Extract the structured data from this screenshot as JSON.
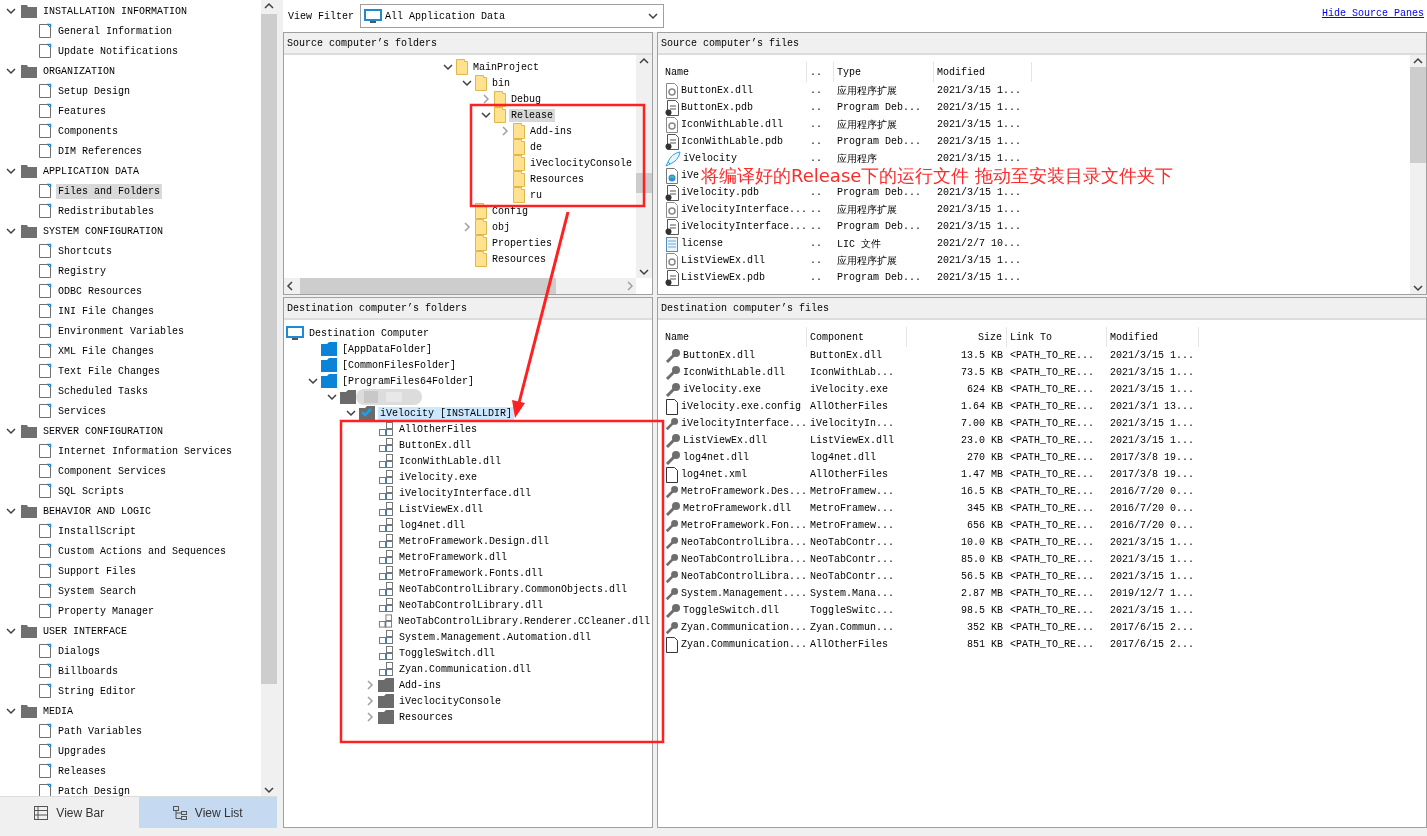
{
  "sidebar": {
    "groups": [
      {
        "label": "INSTALLATION INFORMATION",
        "expanded": true,
        "items": [
          {
            "label": "General Information",
            "selected": false
          },
          {
            "label": "Update Notifications",
            "selected": false
          }
        ]
      },
      {
        "label": "ORGANIZATION",
        "expanded": true,
        "items": [
          {
            "label": "Setup Design",
            "selected": false
          },
          {
            "label": "Features",
            "selected": false
          },
          {
            "label": "Components",
            "selected": false
          },
          {
            "label": "DIM References",
            "selected": false
          }
        ]
      },
      {
        "label": "APPLICATION DATA",
        "expanded": true,
        "items": [
          {
            "label": "Files and Folders",
            "selected": true
          },
          {
            "label": "Redistributables",
            "selected": false
          }
        ]
      },
      {
        "label": "SYSTEM CONFIGURATION",
        "expanded": true,
        "items": [
          {
            "label": "Shortcuts",
            "selected": false
          },
          {
            "label": "Registry",
            "selected": false
          },
          {
            "label": "ODBC Resources",
            "selected": false
          },
          {
            "label": "INI File Changes",
            "selected": false
          },
          {
            "label": "Environment Variables",
            "selected": false
          },
          {
            "label": "XML File Changes",
            "selected": false
          },
          {
            "label": "Text File Changes",
            "selected": false
          },
          {
            "label": "Scheduled Tasks",
            "selected": false
          },
          {
            "label": "Services",
            "selected": false
          }
        ]
      },
      {
        "label": "SERVER CONFIGURATION",
        "expanded": true,
        "items": [
          {
            "label": "Internet Information Services",
            "selected": false
          },
          {
            "label": "Component Services",
            "selected": false
          },
          {
            "label": "SQL Scripts",
            "selected": false
          }
        ]
      },
      {
        "label": "BEHAVIOR AND LOGIC",
        "expanded": true,
        "items": [
          {
            "label": "InstallScript",
            "selected": false
          },
          {
            "label": "Custom Actions and Sequences",
            "selected": false
          },
          {
            "label": "Support Files",
            "selected": false
          },
          {
            "label": "System Search",
            "selected": false
          },
          {
            "label": "Property Manager",
            "selected": false
          }
        ]
      },
      {
        "label": "USER INTERFACE",
        "expanded": true,
        "items": [
          {
            "label": "Dialogs",
            "selected": false
          },
          {
            "label": "Billboards",
            "selected": false
          },
          {
            "label": "String Editor",
            "selected": false
          }
        ]
      },
      {
        "label": "MEDIA",
        "expanded": true,
        "items": [
          {
            "label": "Path Variables",
            "selected": false
          },
          {
            "label": "Upgrades",
            "selected": false
          },
          {
            "label": "Releases",
            "selected": false
          },
          {
            "label": "Patch Design",
            "selected": false
          }
        ]
      }
    ],
    "tabs": [
      {
        "label": "View Bar",
        "selected": false
      },
      {
        "label": "View List",
        "selected": true
      }
    ]
  },
  "toolbar": {
    "filter_label": "View Filter",
    "filter_value": "All Application Data",
    "link": "Hide Source Panes"
  },
  "source_folders": {
    "title": "Source computer’s folders",
    "tree": [
      {
        "label": "MainProject",
        "expanded": true,
        "selected": false,
        "children": [
          {
            "label": "bin",
            "expanded": true,
            "selected": false,
            "children": [
              {
                "label": "Debug",
                "expanded": false,
                "selected": false
              },
              {
                "label": "Release",
                "expanded": true,
                "selected": true,
                "children": [
                  {
                    "label": "Add-ins",
                    "expanded": false,
                    "selected": false
                  },
                  {
                    "label": "de",
                    "selected": false
                  },
                  {
                    "label": "iVeclocityConsole",
                    "selected": false
                  },
                  {
                    "label": "Resources",
                    "selected": false
                  },
                  {
                    "label": "ru",
                    "selected": false
                  }
                ]
              }
            ]
          },
          {
            "label": "Config",
            "selected": false
          },
          {
            "label": "obj",
            "expanded": false,
            "selected": false
          },
          {
            "label": "Properties",
            "selected": false
          },
          {
            "label": "Resources",
            "selected": false
          }
        ]
      }
    ]
  },
  "source_files": {
    "title": "Source computer’s files",
    "columns": [
      "Name",
      "..",
      "Type",
      "Modified"
    ],
    "rows": [
      {
        "kind": "dll",
        "cells": [
          "ButtonEx.dll",
          "..",
          "应用程序扩展",
          "2021/3/15 1..."
        ]
      },
      {
        "kind": "pdb",
        "cells": [
          "ButtonEx.pdb",
          "..",
          "Program Deb...",
          "2021/3/15 1..."
        ]
      },
      {
        "kind": "dll",
        "cells": [
          "IconWithLable.dll",
          "..",
          "应用程序扩展",
          "2021/3/15 1..."
        ]
      },
      {
        "kind": "pdb",
        "cells": [
          "IconWithLable.pdb",
          "..",
          "Program Deb...",
          "2021/3/15 1..."
        ]
      },
      {
        "kind": "app",
        "cells": [
          "iVelocity",
          "..",
          "应用程序",
          "2021/3/15 1..."
        ]
      },
      {
        "kind": "xml",
        "cells": [
          "iVe"
        ]
      },
      {
        "kind": "pdb",
        "cells": [
          "iVelocity.pdb",
          "..",
          "Program Deb...",
          "2021/3/15 1..."
        ]
      },
      {
        "kind": "dll",
        "cells": [
          "iVelocityInterface...",
          "..",
          "应用程序扩展",
          "2021/3/15 1..."
        ]
      },
      {
        "kind": "pdb",
        "cells": [
          "iVelocityInterface...",
          "..",
          "Program Deb...",
          "2021/3/15 1..."
        ]
      },
      {
        "kind": "text",
        "cells": [
          "license",
          "..",
          "LIC 文件",
          "2021/2/7 10..."
        ]
      },
      {
        "kind": "dll",
        "cells": [
          "ListViewEx.dll",
          "..",
          "应用程序扩展",
          "2021/3/15 1..."
        ]
      },
      {
        "kind": "pdb",
        "cells": [
          "ListViewEx.pdb",
          "..",
          "Program Deb...",
          "2021/3/15 1..."
        ]
      }
    ]
  },
  "destination_folders": {
    "title": "Destination computer’s folders",
    "tree": [
      {
        "kind": "computer",
        "label": "Destination Computer",
        "selected": false,
        "children": [
          {
            "kind": "system-folder",
            "label": "[AppDataFolder]",
            "selected": false
          },
          {
            "kind": "system-folder",
            "label": "[CommonFilesFolder]",
            "selected": false
          },
          {
            "kind": "system-folder",
            "label": "[ProgramFiles64Folder]",
            "expanded": true,
            "selected": false,
            "children": [
              {
                "kind": "redacted",
                "expanded": true,
                "children": [
                  {
                    "kind": "install-folder",
                    "label": "iVelocity [INSTALLDIR]",
                    "expanded": true,
                    "selected": true,
                    "children": [
                      {
                        "kind": "component",
                        "label": "AllOtherFiles",
                        "selected": false
                      },
                      {
                        "kind": "component",
                        "label": "ButtonEx.dll",
                        "selected": false
                      },
                      {
                        "kind": "component",
                        "label": "IconWithLable.dll",
                        "selected": false
                      },
                      {
                        "kind": "component",
                        "label": "iVelocity.exe",
                        "selected": false
                      },
                      {
                        "kind": "component",
                        "label": "iVelocityInterface.dll",
                        "selected": false
                      },
                      {
                        "kind": "component",
                        "label": "ListViewEx.dll",
                        "selected": false
                      },
                      {
                        "kind": "component",
                        "label": "log4net.dll",
                        "selected": false
                      },
                      {
                        "kind": "component",
                        "label": "MetroFramework.Design.dll",
                        "selected": false
                      },
                      {
                        "kind": "component",
                        "label": "MetroFramework.dll",
                        "selected": false
                      },
                      {
                        "kind": "component",
                        "label": "MetroFramework.Fonts.dll",
                        "selected": false
                      },
                      {
                        "kind": "component",
                        "label": "NeoTabControlLibrary.CommonObjects.dll",
                        "selected": false
                      },
                      {
                        "kind": "component",
                        "label": "NeoTabControlLibrary.dll",
                        "selected": false
                      },
                      {
                        "kind": "component",
                        "label": "NeoTabControlLibrary.Renderer.CCleaner.dll",
                        "selected": false
                      },
                      {
                        "kind": "component",
                        "label": "System.Management.Automation.dll",
                        "selected": false
                      },
                      {
                        "kind": "component",
                        "label": "ToggleSwitch.dll",
                        "selected": false
                      },
                      {
                        "kind": "component",
                        "label": "Zyan.Communication.dll",
                        "selected": false
                      },
                      {
                        "kind": "folder",
                        "label": "Add-ins",
                        "expanded": false,
                        "selected": false
                      },
                      {
                        "kind": "folder",
                        "label": "iVeclocityConsole",
                        "expanded": false,
                        "selected": false
                      },
                      {
                        "kind": "folder",
                        "label": "Resources",
                        "expanded": false,
                        "selected": false
                      }
                    ]
                  }
                ]
              }
            ]
          }
        ]
      }
    ]
  },
  "destination_files": {
    "title": "Destination computer’s files",
    "columns": [
      "Name",
      "Component",
      "Size",
      "Link To",
      "Modified"
    ],
    "rows": [
      {
        "kind": "key",
        "cells": [
          "ButtonEx.dll",
          "ButtonEx.dll",
          "13.5 KB",
          "<PATH_TO_RE...",
          "2021/3/15 1..."
        ]
      },
      {
        "kind": "key",
        "cells": [
          "IconWithLable.dll",
          "IconWithLab...",
          "73.5 KB",
          "<PATH_TO_RE...",
          "2021/3/15 1..."
        ]
      },
      {
        "kind": "key",
        "cells": [
          "iVelocity.exe",
          "iVelocity.exe",
          "624 KB",
          "<PATH_TO_RE...",
          "2021/3/15 1..."
        ]
      },
      {
        "kind": "file",
        "cells": [
          "iVelocity.exe.config",
          "AllOtherFiles",
          "1.64 KB",
          "<PATH_TO_RE...",
          "2021/3/1 13..."
        ]
      },
      {
        "kind": "key",
        "cells": [
          "iVelocityInterface...",
          "iVelocityIn...",
          "7.00 KB",
          "<PATH_TO_RE...",
          "2021/3/15 1..."
        ]
      },
      {
        "kind": "key",
        "cells": [
          "ListViewEx.dll",
          "ListViewEx.dll",
          "23.0 KB",
          "<PATH_TO_RE...",
          "2021/3/15 1..."
        ]
      },
      {
        "kind": "key",
        "cells": [
          "log4net.dll",
          "log4net.dll",
          "270 KB",
          "<PATH_TO_RE...",
          "2017/3/8 19..."
        ]
      },
      {
        "kind": "file",
        "cells": [
          "log4net.xml",
          "AllOtherFiles",
          "1.47 MB",
          "<PATH_TO_RE...",
          "2017/3/8 19..."
        ]
      },
      {
        "kind": "key",
        "cells": [
          "MetroFramework.Des...",
          "MetroFramew...",
          "16.5 KB",
          "<PATH_TO_RE...",
          "2016/7/20 0..."
        ]
      },
      {
        "kind": "key",
        "cells": [
          "MetroFramework.dll",
          "MetroFramew...",
          "345 KB",
          "<PATH_TO_RE...",
          "2016/7/20 0..."
        ]
      },
      {
        "kind": "key",
        "cells": [
          "MetroFramework.Fon...",
          "MetroFramew...",
          "656 KB",
          "<PATH_TO_RE...",
          "2016/7/20 0..."
        ]
      },
      {
        "kind": "key",
        "cells": [
          "NeoTabControlLibra...",
          "NeoTabContr...",
          "10.0 KB",
          "<PATH_TO_RE...",
          "2021/3/15 1..."
        ]
      },
      {
        "kind": "key",
        "cells": [
          "NeoTabControlLibra...",
          "NeoTabContr...",
          "85.0 KB",
          "<PATH_TO_RE...",
          "2021/3/15 1..."
        ]
      },
      {
        "kind": "key",
        "cells": [
          "NeoTabControlLibra...",
          "NeoTabContr...",
          "56.5 KB",
          "<PATH_TO_RE...",
          "2021/3/15 1..."
        ]
      },
      {
        "kind": "key",
        "cells": [
          "System.Management....",
          "System.Mana...",
          "2.87 MB",
          "<PATH_TO_RE...",
          "2019/12/7 1..."
        ]
      },
      {
        "kind": "key",
        "cells": [
          "ToggleSwitch.dll",
          "ToggleSwitc...",
          "98.5 KB",
          "<PATH_TO_RE...",
          "2021/3/15 1..."
        ]
      },
      {
        "kind": "key",
        "cells": [
          "Zyan.Communication...",
          "Zyan.Commun...",
          "352 KB",
          "<PATH_TO_RE...",
          "2017/6/15 2..."
        ]
      },
      {
        "kind": "file",
        "cells": [
          "Zyan.Communication...",
          "AllOtherFiles",
          "851 KB",
          "<PATH_TO_RE...",
          "2017/6/15 2..."
        ]
      }
    ]
  },
  "annotation": {
    "note": "将编译好的Release下的运行文件 拖动至安装目录文件夹下"
  }
}
